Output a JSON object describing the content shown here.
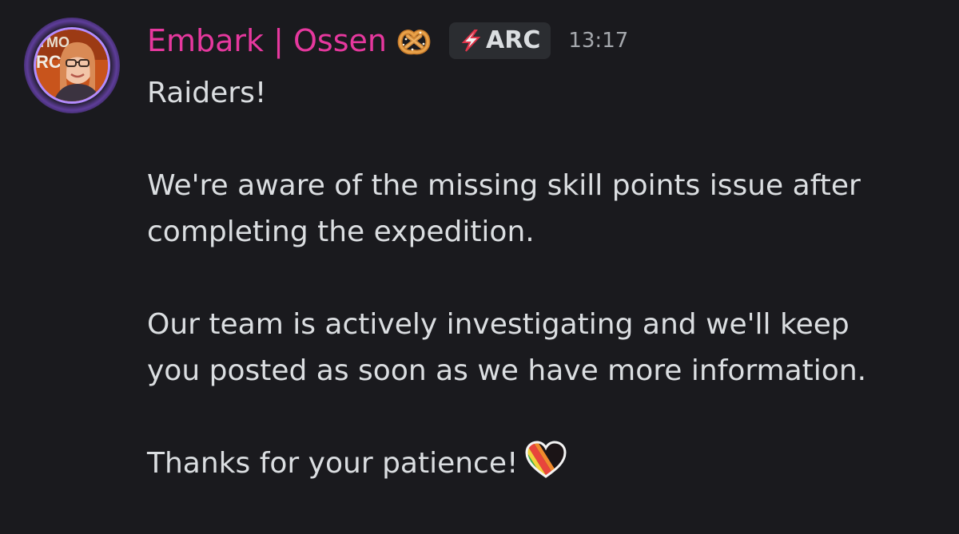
{
  "message": {
    "author": "Embark | Ossen",
    "author_color": "#e6389e",
    "author_emoji": "pretzel-emoji",
    "tag": {
      "icon": "lightning-bolt-icon",
      "label": "ARC"
    },
    "timestamp": "13:17",
    "lines": {
      "l1": "Raiders!",
      "l2": "We're aware of the missing skill points issue after",
      "l3": "completing the expedition.",
      "l4": "Our team is actively investigating and we'll keep",
      "l5": "you posted as soon as we have more information.",
      "l6": "Thanks for your patience!"
    },
    "trailing_emoji": "rainbow-heart-emoji"
  }
}
